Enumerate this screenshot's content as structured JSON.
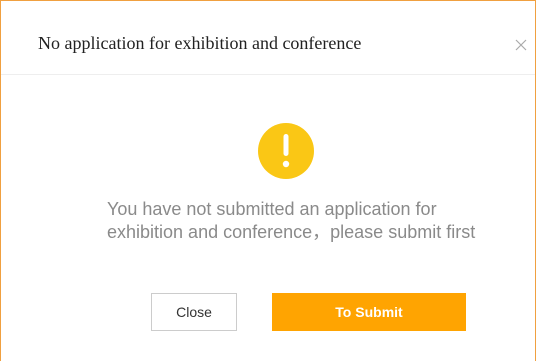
{
  "dialog": {
    "title": "No application for exhibition and conference",
    "close_icon": "close-icon",
    "warning_icon": "exclamation-icon",
    "warning_color": "#fac715",
    "message": "You have not submitted an application for exhibition and conference，please submit first",
    "close_label": "Close",
    "submit_label": "To Submit",
    "accent_color": "#ffa401"
  }
}
